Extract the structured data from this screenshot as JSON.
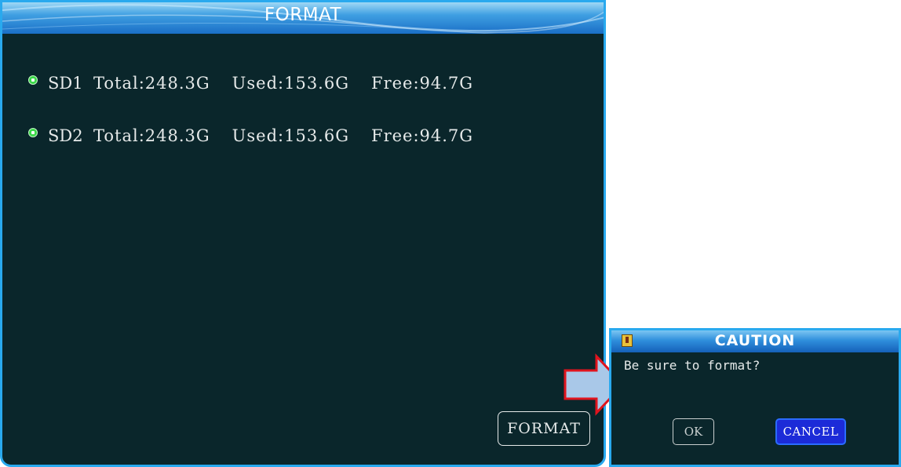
{
  "format_window": {
    "title": "FORMAT",
    "disks": [
      {
        "name": "SD1",
        "total": "Total:248.3G",
        "used": "Used:153.6G",
        "free": "Free:94.7G"
      },
      {
        "name": "SD2",
        "total": "Total:248.3G",
        "used": "Used:153.6G",
        "free": "Free:94.7G"
      }
    ],
    "format_button": "FORMAT"
  },
  "caution_dialog": {
    "title": "CAUTION",
    "message": "Be sure to format?",
    "ok_button": "OK",
    "cancel_button": "CANCEL"
  },
  "icons": {
    "disk_radio": "radio-selected-icon",
    "dialog_icon": "warning-icon",
    "pointer": "right-arrow-icon"
  },
  "colors": {
    "window_bg": "#0a262b",
    "title_bar": "#1a6ec6",
    "border": "#29a9ee",
    "radio": "#3bd84a",
    "cancel_bg": "#1c2bd8",
    "arrow_fill": "#a9c8e8",
    "arrow_border": "#e0141e"
  }
}
